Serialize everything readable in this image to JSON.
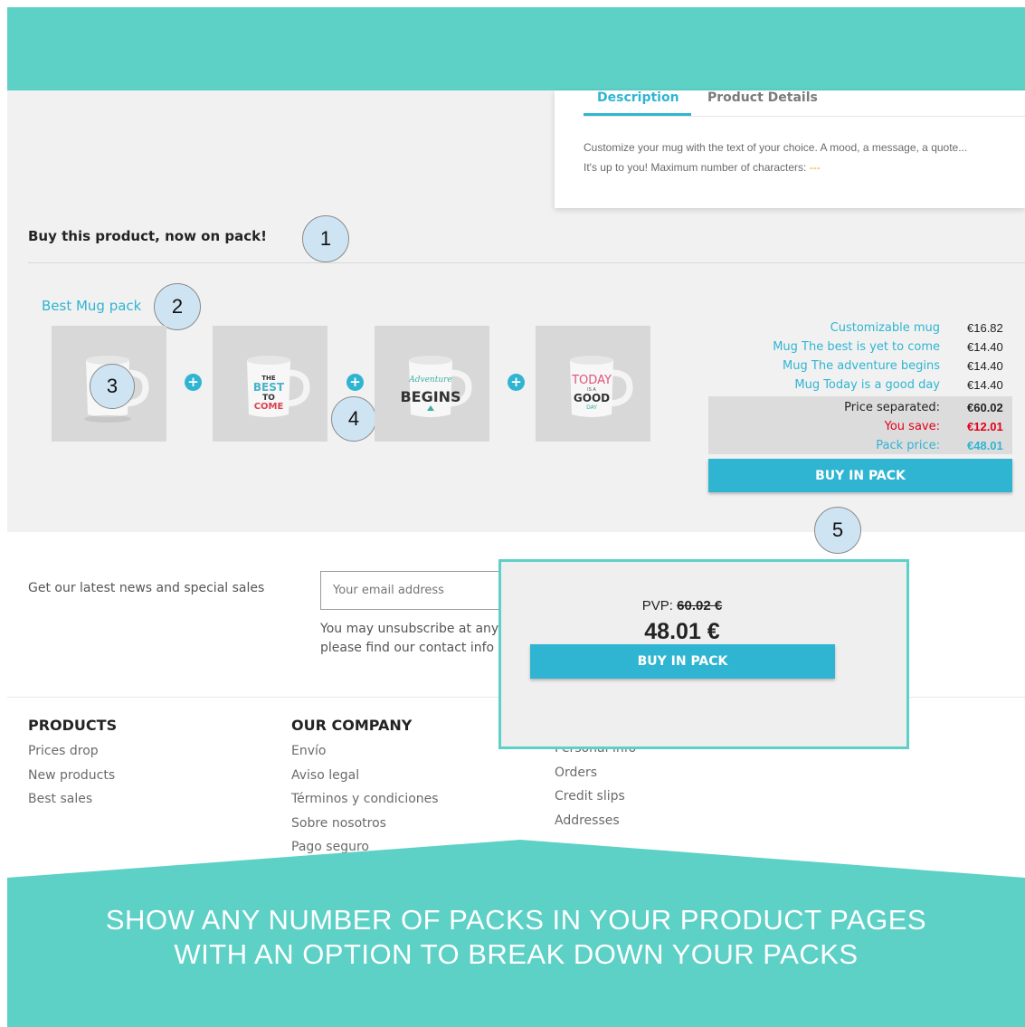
{
  "tabs": [
    {
      "label": "Description",
      "active": true
    },
    {
      "label": "Product Details",
      "active": false
    }
  ],
  "description": {
    "line1": "Customize your mug with the text of your choice. A mood, a message, a quote...",
    "line2_prefix": "It's up to you! Maximum number of characters: ",
    "line2_suffix": "---"
  },
  "pack_section": {
    "heading": "Buy this product, now on pack!",
    "pack_name": "Best Mug pack",
    "items": [
      {
        "name": "Customizable mug",
        "price": "€16.82",
        "mug_text": ""
      },
      {
        "name": "Mug The best is yet to come",
        "price": "€14.40",
        "mug_text": "THE BEST IS YET TO COME"
      },
      {
        "name": "Mug The adventure begins",
        "price": "€14.40",
        "mug_text": "The Adventure BEGINS"
      },
      {
        "name": "Mug Today is a good day",
        "price": "€14.40",
        "mug_text": "TODAY IS A GOOD DAY"
      }
    ],
    "price_separated_label": "Price separated:",
    "price_separated_value": "€60.02",
    "you_save_label": "You save:",
    "you_save_value": "€12.01",
    "pack_price_label": "Pack price:",
    "pack_price_value": "€48.01",
    "buy_button": "BUY IN PACK"
  },
  "callouts": [
    "1",
    "2",
    "3",
    "4",
    "5"
  ],
  "newsletter": {
    "text": "Get our latest news and special sales",
    "email_placeholder": "Your email address",
    "unsubscribe_line1": "You may unsubscribe at any moment. For that purpose,",
    "unsubscribe_line2": "please find our contact info in the legal notice."
  },
  "popup": {
    "pvp_label": "PVP: ",
    "pvp_value": "60.02 €",
    "price": "48.01 €",
    "buy_button": "BUY IN PACK"
  },
  "footer": {
    "products": {
      "title": "PRODUCTS",
      "links": [
        "Prices drop",
        "New products",
        "Best sales"
      ]
    },
    "company": {
      "title": "OUR COMPANY",
      "links": [
        "Envío",
        "Aviso legal",
        "Términos y condiciones",
        "Sobre nosotros",
        "Pago seguro"
      ]
    },
    "account": {
      "links": [
        "Personal info",
        "Orders",
        "Credit slips",
        "Addresses"
      ]
    }
  },
  "banner": {
    "line1": "SHOW ANY NUMBER OF PACKS IN YOUR PRODUCT PAGES",
    "line2": "WITH AN OPTION TO BREAK DOWN YOUR PACKS"
  },
  "colors": {
    "teal": "#5dd1c6",
    "accent_blue": "#2fb5d2",
    "save_red": "#e2001a",
    "background_gray": "#f1f1f1"
  }
}
